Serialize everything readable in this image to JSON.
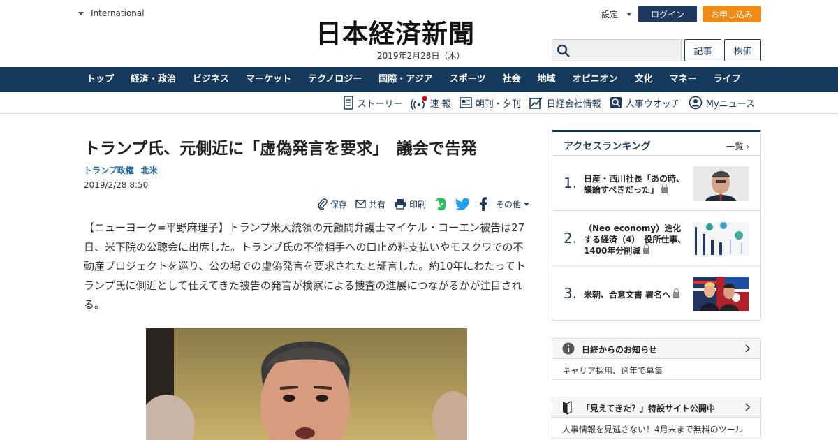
{
  "header": {
    "edition": "International",
    "logo": "日本経済新聞",
    "date": "2019年2月28日（木）",
    "settings": "設定",
    "login": "ログイン",
    "apply": "お申し込み",
    "search_placeholder": "",
    "btn_articles": "記事",
    "btn_stocks": "株価"
  },
  "nav": [
    "トップ",
    "経済・政治",
    "ビジネス",
    "マーケット",
    "テクノロジー",
    "国際・アジア",
    "スポーツ",
    "社会",
    "地域",
    "オピニオン",
    "文化",
    "マネー",
    "ライフ"
  ],
  "subnav": [
    {
      "label": "ストーリー",
      "icon": "story-icon"
    },
    {
      "label": "速 報",
      "icon": "breaking-news-icon"
    },
    {
      "label": "朝刊・夕刊",
      "icon": "newspaper-icon"
    },
    {
      "label": "日経会社情報",
      "icon": "company-chart-icon"
    },
    {
      "label": "人事ウオッチ",
      "icon": "search-person-icon"
    },
    {
      "label": "Myニュース",
      "icon": "user-icon"
    }
  ],
  "article": {
    "title": "トランプ氏、元側近に「虚偽発言を要求」　議会で告発",
    "tags": [
      "トランプ政権",
      "北米"
    ],
    "date": "2019/2/28 8:50",
    "tools": {
      "save": "保存",
      "share": "共有",
      "print": "印刷",
      "more": "その他"
    },
    "body": "【ニューヨーク=平野麻理子】トランプ米大統領の元顧問弁護士マイケル・コーエン被告は27日、米下院の公聴会に出席した。トランプ氏の不倫相手への口止め料支払いやモスクワでの不動産プロジェクトを巡り、公の場での虚偽発言を要求されたと証言した。約10年にわたってトランプ氏に側近として仕えてきた被告の発言が検察による捜査の進展につながるかが注目される。"
  },
  "ranking": {
    "title": "アクセスランキング",
    "more": "一覧",
    "items": [
      {
        "rank": "1.",
        "text": "日産・西川社長「あの時、議論すべきだった」"
      },
      {
        "rank": "2.",
        "text": "（Neo economy）進化する経済（4）　役所仕事、1400年分削減"
      },
      {
        "rank": "3.",
        "text": "米朝、合意文書 署名へ"
      }
    ]
  },
  "notice": {
    "title": "日経からのお知らせ",
    "body": "キャリア採用、通年で募集"
  },
  "promo": {
    "title": "「見えてきた？」特設サイト公開中",
    "body": "人事情報を見逃さない！4月末まで無料のツール"
  },
  "colors": {
    "navy": "#163a5c",
    "orange": "#f08a13",
    "link": "#1b6ba8"
  }
}
